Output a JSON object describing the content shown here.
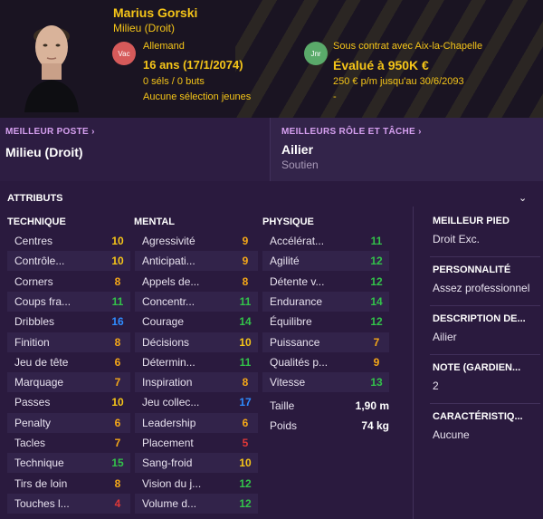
{
  "player": {
    "name": "Marius Gorski",
    "position": "Milieu (Droit)",
    "nationality": "Allemand",
    "age": "16 ans (17/1/2074)",
    "caps": "0 séls / 0 buts",
    "youth_caps": "Aucune sélection jeunes",
    "contract": "Sous contrat avec Aix-la-Chapelle",
    "value": "Évalué à 950K €",
    "wage": "250 € p/m jusqu'au 30/6/2093",
    "dash": "-"
  },
  "badges": {
    "left": "Vac",
    "right": "Jnr"
  },
  "best_position": {
    "title": "MEILLEUR POSTE",
    "value": "Milieu (Droit)"
  },
  "best_role": {
    "title": "MEILLEURS RÔLE ET TÂCHE",
    "value": "Ailier",
    "duty": "Soutien"
  },
  "attributes": {
    "title": "ATTRIBUTS",
    "technical": {
      "header": "TECHNIQUE",
      "rows": [
        {
          "label": "Centres",
          "value": "10",
          "color": "yellow"
        },
        {
          "label": "Contrôle...",
          "value": "10",
          "color": "yellow"
        },
        {
          "label": "Corners",
          "value": "8",
          "color": "orange"
        },
        {
          "label": "Coups fra...",
          "value": "11",
          "color": "green"
        },
        {
          "label": "Dribbles",
          "value": "16",
          "color": "blue"
        },
        {
          "label": "Finition",
          "value": "8",
          "color": "orange"
        },
        {
          "label": "Jeu de tête",
          "value": "6",
          "color": "orange"
        },
        {
          "label": "Marquage",
          "value": "7",
          "color": "orange"
        },
        {
          "label": "Passes",
          "value": "10",
          "color": "yellow"
        },
        {
          "label": "Penalty",
          "value": "6",
          "color": "orange"
        },
        {
          "label": "Tacles",
          "value": "7",
          "color": "orange"
        },
        {
          "label": "Technique",
          "value": "15",
          "color": "green"
        },
        {
          "label": "Tirs de loin",
          "value": "8",
          "color": "orange"
        },
        {
          "label": "Touches l...",
          "value": "4",
          "color": "red"
        }
      ]
    },
    "mental": {
      "header": "MENTAL",
      "rows": [
        {
          "label": "Agressivité",
          "value": "9",
          "color": "orange"
        },
        {
          "label": "Anticipati...",
          "value": "9",
          "color": "orange"
        },
        {
          "label": "Appels de...",
          "value": "8",
          "color": "orange"
        },
        {
          "label": "Concentr...",
          "value": "11",
          "color": "green"
        },
        {
          "label": "Courage",
          "value": "14",
          "color": "green"
        },
        {
          "label": "Décisions",
          "value": "10",
          "color": "yellow"
        },
        {
          "label": "Détermin...",
          "value": "11",
          "color": "green"
        },
        {
          "label": "Inspiration",
          "value": "8",
          "color": "orange"
        },
        {
          "label": "Jeu collec...",
          "value": "17",
          "color": "blue"
        },
        {
          "label": "Leadership",
          "value": "6",
          "color": "orange"
        },
        {
          "label": "Placement",
          "value": "5",
          "color": "red"
        },
        {
          "label": "Sang-froid",
          "value": "10",
          "color": "yellow"
        },
        {
          "label": "Vision du j...",
          "value": "12",
          "color": "green"
        },
        {
          "label": "Volume d...",
          "value": "12",
          "color": "green"
        }
      ]
    },
    "physical": {
      "header": "PHYSIQUE",
      "rows": [
        {
          "label": "Accélérat...",
          "value": "11",
          "color": "green"
        },
        {
          "label": "Agilité",
          "value": "12",
          "color": "green"
        },
        {
          "label": "Détente v...",
          "value": "12",
          "color": "green"
        },
        {
          "label": "Endurance",
          "value": "14",
          "color": "green"
        },
        {
          "label": "Équilibre",
          "value": "12",
          "color": "green"
        },
        {
          "label": "Puissance",
          "value": "7",
          "color": "orange"
        },
        {
          "label": "Qualités p...",
          "value": "9",
          "color": "orange"
        },
        {
          "label": "Vitesse",
          "value": "13",
          "color": "green"
        }
      ],
      "extra": [
        {
          "label": "Taille",
          "value": "1,90 m"
        },
        {
          "label": "Poids",
          "value": "74 kg"
        }
      ]
    }
  },
  "side": {
    "best_foot_label": "MEILLEUR PIED",
    "best_foot": "Droit Exc.",
    "personality_label": "PERSONNALITÉ",
    "personality": "Assez professionnel",
    "description_label": "DESCRIPTION DE...",
    "description": "Ailier",
    "note_label": "NOTE (GARDIEN...",
    "note": "2",
    "traits_label": "CARACTÉRISTIQ...",
    "traits": "Aucune"
  },
  "colors": {
    "yellow": "#f5c518",
    "orange": "#f5a818",
    "green": "#33c24a",
    "blue": "#2f8cff",
    "red": "#e03838",
    "accent": "#d6a0f0"
  }
}
